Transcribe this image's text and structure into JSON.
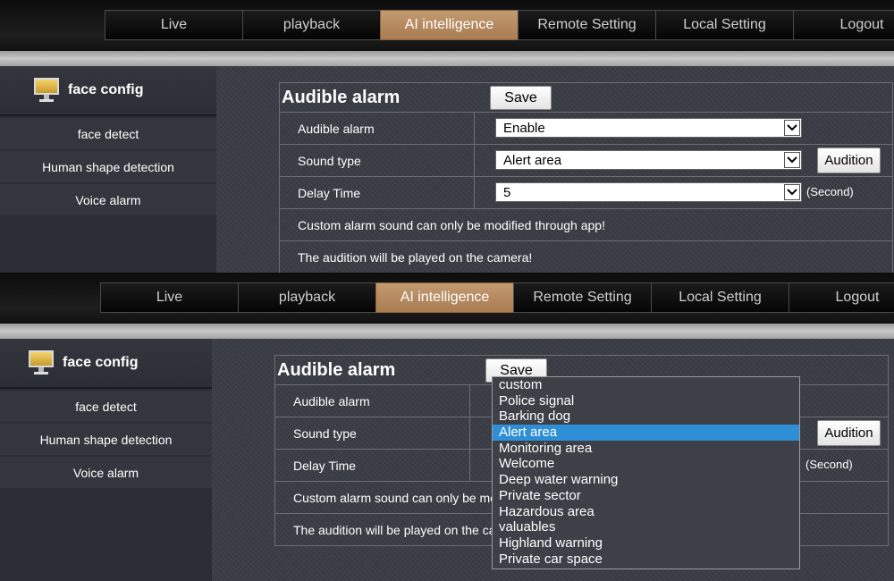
{
  "nav": {
    "items": [
      {
        "label": "Live"
      },
      {
        "label": "playback"
      },
      {
        "label": "AI intelligence",
        "active": true
      },
      {
        "label": "Remote Setting"
      },
      {
        "label": "Local Setting"
      },
      {
        "label": "Logout"
      }
    ]
  },
  "sidebar": {
    "header": {
      "label": "face config",
      "icon": "monitor-icon"
    },
    "items": [
      {
        "label": "face detect"
      },
      {
        "label": "Human shape detection"
      },
      {
        "label": "Voice alarm"
      }
    ]
  },
  "form": {
    "title": "Audible alarm",
    "save_label": "Save",
    "rows": {
      "audible_alarm": {
        "label": "Audible alarm",
        "value": "Enable"
      },
      "sound_type": {
        "label": "Sound type",
        "value": "Alert area",
        "button": "Audition"
      },
      "delay_time": {
        "label": "Delay Time",
        "value": "5",
        "unit": "(Second)"
      }
    },
    "notes": {
      "custom": "Custom alarm sound can only be modified through app!",
      "audition": "The audition will be played on the camera!",
      "custom_truncated": "Custom alarm sound can only be mo",
      "audition_truncated": "The audition will be played on the ca"
    }
  },
  "sound_type_options": {
    "items": [
      "custom",
      "Police signal",
      "Barking dog",
      "Alert area",
      "Monitoring area",
      "Welcome",
      "Deep water warning",
      "Private sector",
      "Hazardous area",
      "valuables",
      "Highland warning",
      "Private car space"
    ],
    "selected": "Alert area",
    "highlight_color": "#2f8fd6"
  },
  "colors": {
    "accent": "#b8895e",
    "background": "#3a3d44",
    "sidebar": "#33363c"
  }
}
